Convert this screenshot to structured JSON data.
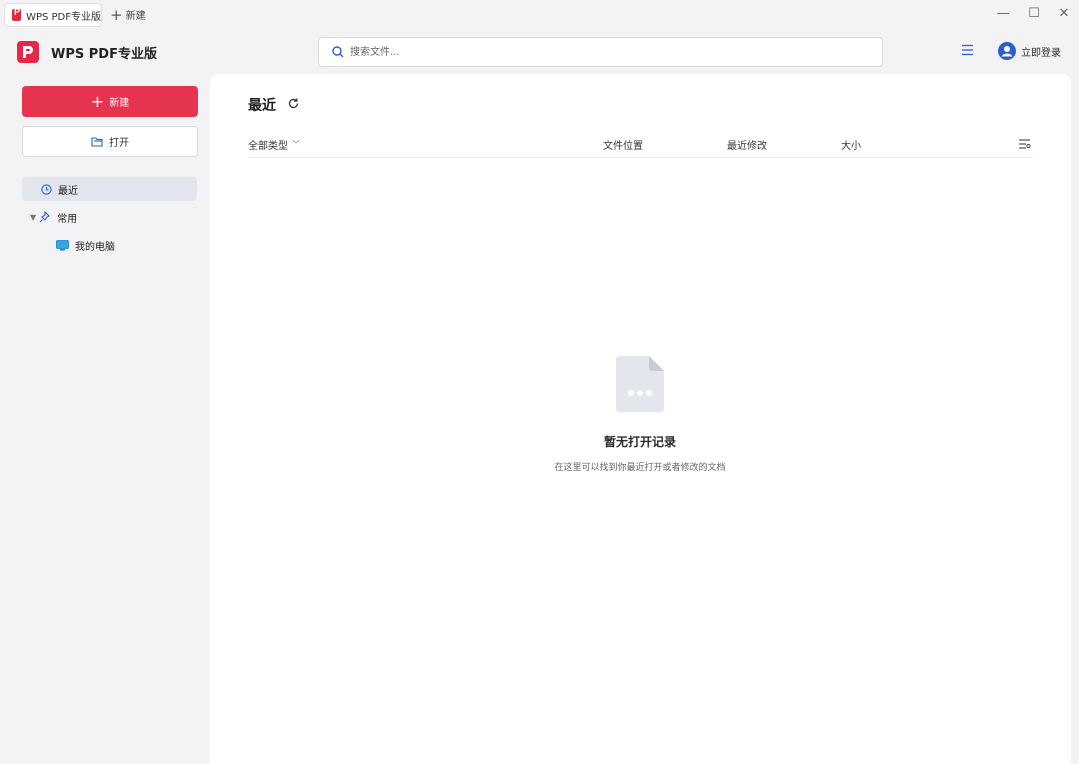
{
  "titlebar": {
    "tab_label": "WPS PDF专业版",
    "new_tab_label": "新建",
    "controls": {
      "minimize": "—",
      "maximize": "☐",
      "close": "✕"
    }
  },
  "header": {
    "app_title": "WPS PDF专业版",
    "search_placeholder": "搜索文件...",
    "login_label": "立即登录"
  },
  "sidebar": {
    "new_button": "新建",
    "open_button": "打开",
    "items": [
      {
        "label": "最近",
        "icon": "clock-icon"
      },
      {
        "label": "常用",
        "icon": "pin-icon"
      },
      {
        "label": "我的电脑",
        "icon": "monitor-icon"
      }
    ]
  },
  "main": {
    "title": "最近",
    "columns": {
      "type": "全部类型",
      "location": "文件位置",
      "modified": "最近修改",
      "size": "大小"
    },
    "empty": {
      "title": "暂无打开记录",
      "subtitle": "在这里可以找到你最近打开或者修改的文档"
    }
  },
  "colors": {
    "accent": "#e5344f",
    "selected_nav": "#e2e4ee",
    "background": "#f3f3f5",
    "brand_blue": "#2b5fc9"
  }
}
